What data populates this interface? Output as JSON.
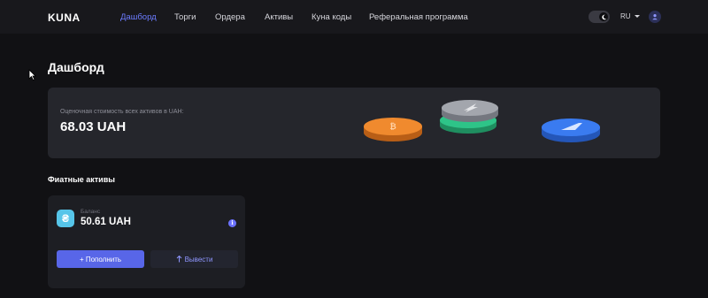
{
  "header": {
    "logo": "KUNA",
    "nav": [
      {
        "label": "Дашборд",
        "active": true
      },
      {
        "label": "Торги",
        "active": false
      },
      {
        "label": "Ордера",
        "active": false
      },
      {
        "label": "Активы",
        "active": false
      },
      {
        "label": "Куна коды",
        "active": false
      },
      {
        "label": "Реферальная программа",
        "active": false
      }
    ],
    "theme_icon": "moon-icon",
    "language": "RU",
    "avatar_icon": "user-icon"
  },
  "page": {
    "title": "Дашборд"
  },
  "portfolio": {
    "label": "Оценочная стоимость всех активов в UAH:",
    "value": "68.03 UAH",
    "coin_colors": [
      "#f08a2e",
      "#2ec488",
      "#a3a6ad",
      "#3a7bf0"
    ]
  },
  "fiat": {
    "section_title": "Фиатные активы",
    "currency_symbol": "₴",
    "balance_label": "Баланс",
    "balance_value": "50.61 UAH",
    "info_icon": "info-icon",
    "deposit_label": "+ Пополнить",
    "withdraw_icon": "arrow-up-icon",
    "withdraw_label": "Вывести"
  },
  "colors": {
    "accent": "#6c7cff",
    "primary_button": "#5866e8",
    "background": "#111114",
    "card": "#25262c"
  }
}
